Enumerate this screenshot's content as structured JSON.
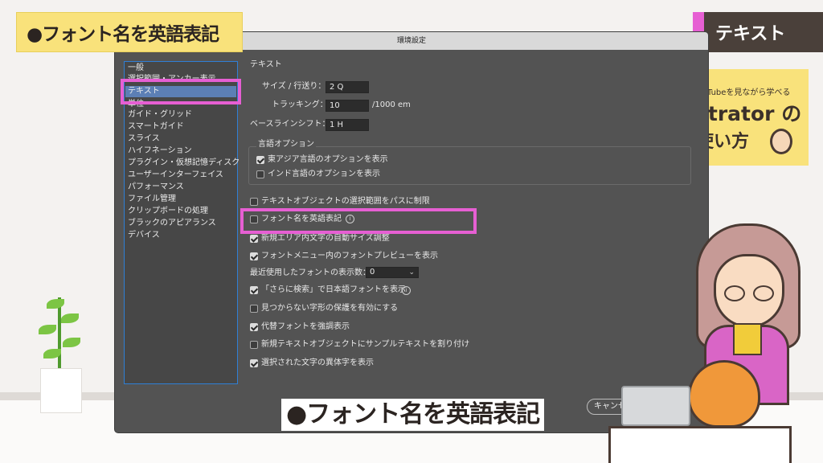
{
  "overlay": {
    "title_banner": "●フォント名を英語表記",
    "tag": "テキスト",
    "subtitle": "●フォント名を英語表記",
    "book": {
      "sub": "Tubeを見ながら学べる",
      "line1": "strator の",
      "line2": "使い方"
    }
  },
  "dialog": {
    "title": "環境設定",
    "sidebar": [
      {
        "label": "一般",
        "selected": false
      },
      {
        "label": "選択範囲・アンカー表示",
        "selected": false
      },
      {
        "label": "テキスト",
        "selected": true
      },
      {
        "label": "単位",
        "selected": false
      },
      {
        "label": "ガイド・グリッド",
        "selected": false
      },
      {
        "label": "スマートガイド",
        "selected": false
      },
      {
        "label": "スライス",
        "selected": false
      },
      {
        "label": "ハイフネーション",
        "selected": false
      },
      {
        "label": "プラグイン・仮想記憶ディスク",
        "selected": false
      },
      {
        "label": "ユーザーインターフェイス",
        "selected": false
      },
      {
        "label": "パフォーマンス",
        "selected": false
      },
      {
        "label": "ファイル管理",
        "selected": false
      },
      {
        "label": "クリップボードの処理",
        "selected": false
      },
      {
        "label": "ブラックのアピアランス",
        "selected": false
      },
      {
        "label": "デバイス",
        "selected": false
      }
    ],
    "section_title": "テキスト",
    "size_label": "サイズ / 行送り：",
    "size_value": "2 Q",
    "tracking_label": "トラッキング：",
    "tracking_value": "10",
    "tracking_unit": "/1000 em",
    "baseline_label": "ベースラインシフト：",
    "baseline_value": "1 H",
    "lang_group_title": "言語オプション",
    "east_asian": {
      "label": "東アジア言語のオプションを表示",
      "checked": true
    },
    "indic": {
      "label": "インド言語のオプションを表示",
      "checked": false
    },
    "options": [
      {
        "label": "テキストオブジェクトの選択範囲をパスに制限",
        "checked": false
      },
      {
        "label": "フォント名を英語表記",
        "checked": false
      },
      {
        "label": "新規エリア内文字の自動サイズ調整",
        "checked": true
      },
      {
        "label": "フォントメニュー内のフォントプレビューを表示",
        "checked": true
      }
    ],
    "recent_fonts_label": "最近使用したフォントの表示数：",
    "recent_fonts_value": "0",
    "options2": [
      {
        "label": "「さらに検索」で日本語フォントを表示",
        "checked": true
      },
      {
        "label": "見つからない字形の保護を有効にする",
        "checked": false
      },
      {
        "label": "代替フォントを強調表示",
        "checked": true
      },
      {
        "label": "新規テキストオブジェクトにサンプルテキストを割り付け",
        "checked": false
      },
      {
        "label": "選択された文字の異体字を表示",
        "checked": true
      }
    ],
    "cancel_label": "キャンセル"
  },
  "icons": [
    "info-icon",
    "chevron-down-icon",
    "check-icon"
  ],
  "colors": {
    "highlight": "#e65fd3",
    "banner": "#f9e27b",
    "dialog_bg": "#535353",
    "selection": "#5c7fb5"
  }
}
